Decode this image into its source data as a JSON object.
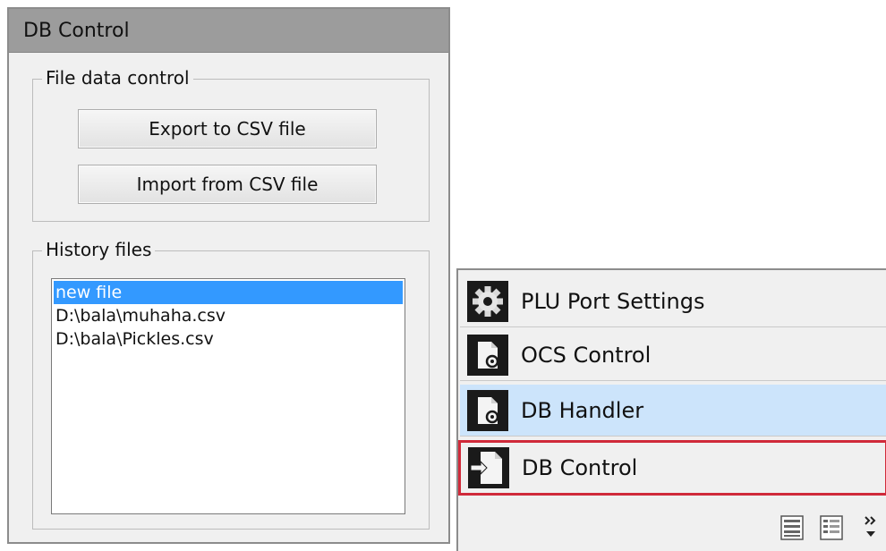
{
  "db_control_panel": {
    "title": "DB Control",
    "file_data_control": {
      "legend": "File data control",
      "export_label": "Export to CSV file",
      "import_label": "Import from CSV file"
    },
    "history_files": {
      "legend": "History files",
      "items": [
        "new file",
        "D:\\bala\\muhaha.csv",
        "D:\\bala\\Pickles.csv"
      ],
      "selected_index": 0
    }
  },
  "navigation": {
    "items": [
      {
        "label": "PLU Port Settings",
        "icon": "gear-icon"
      },
      {
        "label": "OCS Control",
        "icon": "document-gear-icon"
      },
      {
        "label": "DB Handler",
        "icon": "document-gear-icon",
        "state": "hovered"
      },
      {
        "label": "DB Control",
        "icon": "document-arrow-icon",
        "state": "highlighted"
      }
    ],
    "footer": {
      "buttons": [
        "list-view-icon",
        "details-view-icon",
        "overflow-chevron-icon"
      ]
    }
  },
  "colors": {
    "title_bar": "#9c9c9c",
    "selection": "#3399ff",
    "hover_item": "#cce4fb",
    "highlight_border": "#d02a3a"
  }
}
